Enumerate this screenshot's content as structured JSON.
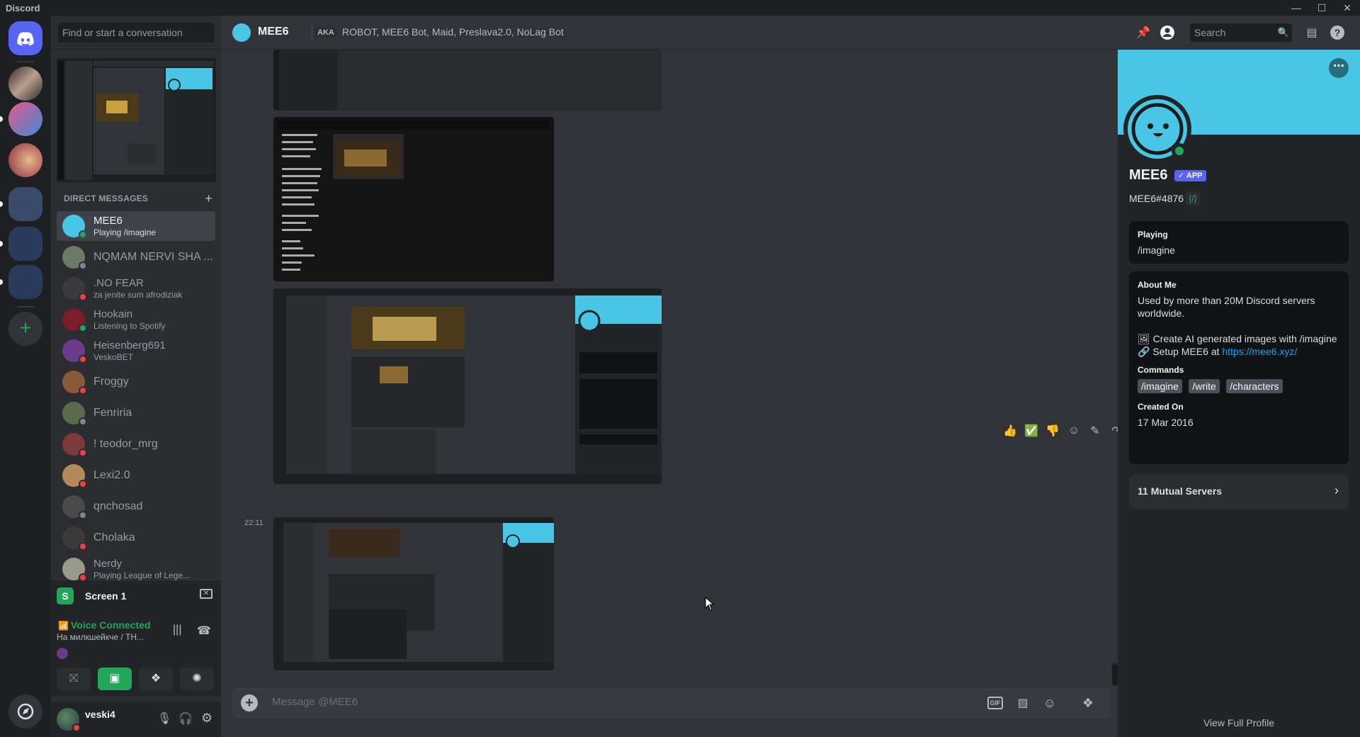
{
  "window": {
    "app_name": "Discord"
  },
  "dm_sidebar": {
    "search_placeholder": "Find or start a conversation",
    "section_title": "DIRECT MESSAGES",
    "items": [
      {
        "name": "MEE6",
        "status_text": "Playing /imagine",
        "status": "online",
        "avatar_color": "#49c6e5",
        "active": true
      },
      {
        "name": "NQMAM NERVI SHA ...",
        "status_text": "",
        "status": "offline",
        "avatar_color": "#6b7a65"
      },
      {
        "name": ".NO FEAR",
        "status_text": "za jenite sum afrodiziak",
        "status": "dnd",
        "avatar_color": "#3a3a3a"
      },
      {
        "name": "Hookain",
        "status_text": "Listening to Spotify",
        "status": "online",
        "avatar_color": "#7a1f2a"
      },
      {
        "name": "Heisenberg691",
        "status_text": "VeskoBET",
        "status": "dnd",
        "avatar_color": "#6a3b8a"
      },
      {
        "name": "Froggy",
        "status_text": "",
        "status": "dnd",
        "avatar_color": "#8a5a3a"
      },
      {
        "name": "Fenriria",
        "status_text": "",
        "status": "offline",
        "avatar_color": "#5a6a4a"
      },
      {
        "name": "! teodor_mrg",
        "status_text": "",
        "status": "dnd",
        "avatar_color": "#7a3a3a"
      },
      {
        "name": "Lexi2.0",
        "status_text": "",
        "status": "dnd",
        "avatar_color": "#b58a5a"
      },
      {
        "name": "qnchosad",
        "status_text": "",
        "status": "offline",
        "avatar_color": "#4a4a4a"
      },
      {
        "name": "Cholaka",
        "status_text": "",
        "status": "dnd",
        "avatar_color": "#3a3a3a"
      },
      {
        "name": "Nerdy",
        "status_text": "Playing League of Lege...",
        "status": "dnd",
        "avatar_color": "#9a9a8a"
      }
    ]
  },
  "screen_share": {
    "label": "Screen 1"
  },
  "voice": {
    "status": "Voice Connected",
    "channel": "На милкшейкче / TH..."
  },
  "user": {
    "name": "veski4"
  },
  "chat_header": {
    "title": "MEE6",
    "aka_label": "AKA",
    "aka_names": "ROBOT, MEE6 Bot, Maid, Preslava2.0, NoLag Bot",
    "search_placeholder": "Search"
  },
  "messages": {
    "timestamp": "22:11"
  },
  "composer": {
    "placeholder": "Message @MEE6",
    "gif_label": "GIF"
  },
  "profile": {
    "name": "MEE6",
    "badge": "APP",
    "tag": "MEE6#4876",
    "playing_title": "Playing",
    "playing_value": "/imagine",
    "about_title": "About Me",
    "about_line1": "Used by more than 20M Discord servers worldwide.",
    "about_line2": "Create AI generated images with /imagine",
    "about_line3_prefix": "Setup MEE6 at ",
    "about_link": "https://mee6.xyz/",
    "commands_title": "Commands",
    "commands": [
      "/imagine",
      "/write",
      "/characters"
    ],
    "created_title": "Created On",
    "created_value": "17 Mar 2016",
    "mutual_servers": "11 Mutual Servers",
    "view_full": "View Full Profile"
  },
  "colors": {
    "accent": "#5865f2",
    "brand_cyan": "#49c6e5",
    "online": "#23a55a",
    "dnd": "#f23f43",
    "offline": "#80848e"
  }
}
